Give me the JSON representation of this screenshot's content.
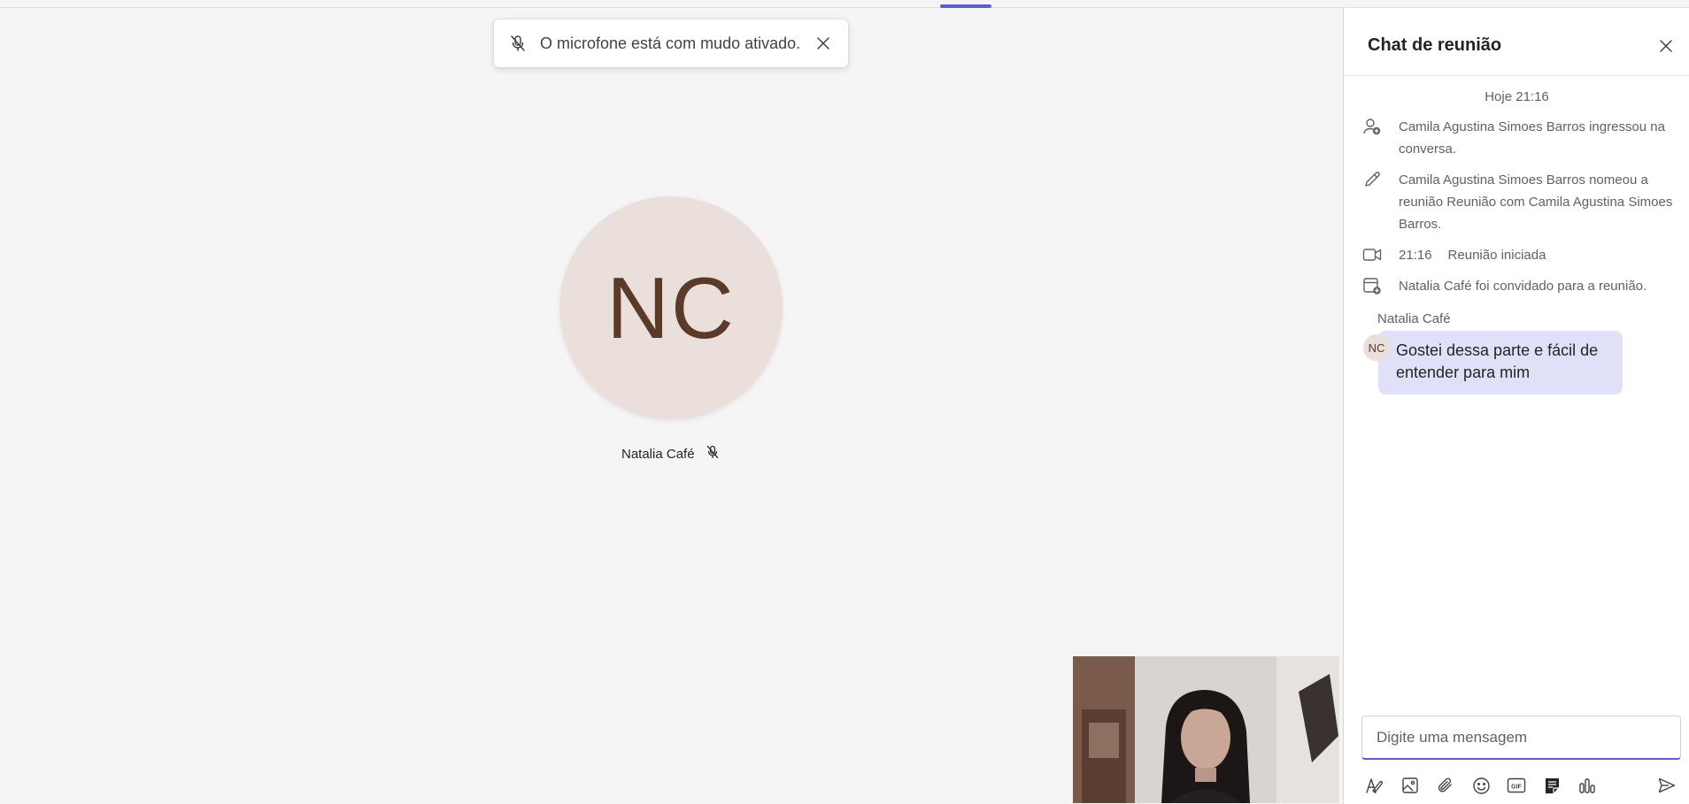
{
  "toast": {
    "text": "O microfone está com mudo ativado."
  },
  "participant": {
    "initials": "NC",
    "name": "Natalia Café"
  },
  "chat": {
    "title": "Chat de reunião",
    "date_header": "Hoje 21:16",
    "events": [
      {
        "icon": "person-add-icon",
        "text": "Camila Agustina Simoes Barros ingressou na conversa."
      },
      {
        "icon": "pencil-icon",
        "text": "Camila Agustina Simoes Barros nomeou a reunião Reunião com Camila Agustina Simoes Barros."
      },
      {
        "icon": "video-camera-icon",
        "time": "21:16",
        "text": "Reunião iniciada"
      },
      {
        "icon": "calendar-add-icon",
        "text": "Natalia Café foi convidado para a reunião."
      }
    ],
    "message": {
      "sender": "Natalia Café",
      "initials": "NC",
      "text": "Gostei dessa parte e fácil de entender para mim"
    },
    "compose": {
      "placeholder": "Digite uma mensagem"
    },
    "toolbar": [
      "format-icon",
      "image-icon",
      "attach-icon",
      "emoji-icon",
      "gif-icon",
      "sticker-icon",
      "poll-icon",
      "send-icon"
    ]
  },
  "colors": {
    "accent": "#5b5fc7",
    "bubble": "#e0e1f8",
    "avatar_bg": "#eadfdb",
    "avatar_text": "#5b3a29"
  }
}
